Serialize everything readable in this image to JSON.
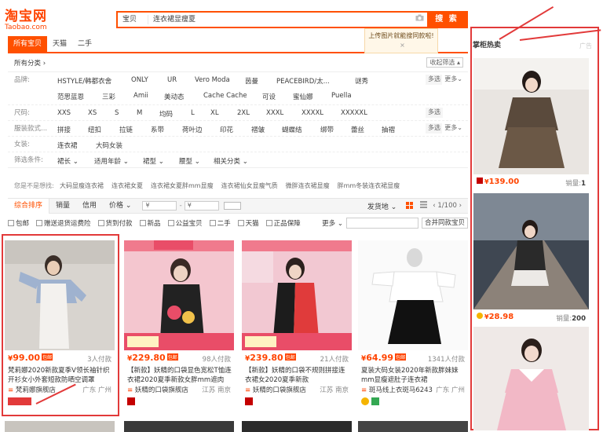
{
  "logo": {
    "cn": "淘宝网",
    "en": "Taobao.com"
  },
  "search": {
    "category": "宝贝",
    "query": "连衣裙显瘦夏",
    "button": "搜 索"
  },
  "tabs": [
    "所有宝贝",
    "天猫",
    "二手"
  ],
  "hint": {
    "text": "上传图片就能搜同款啦!",
    "close": "×"
  },
  "filters": {
    "all_label": "所有分类",
    "collapse": "收起筛选",
    "brand": {
      "label": "品牌:",
      "values": [
        "HSTYLE/韩都衣舍",
        "ONLY",
        "UR",
        "Vero Moda",
        "茵曼",
        "PEACEBIRD/太...",
        "谜秀",
        "范思蓝恩",
        "三彩",
        "Amii",
        "美动态",
        "Cache Cache",
        "可设",
        "蜜仙娜",
        "Puella"
      ],
      "multi": "多选",
      "more": "更多"
    },
    "size": {
      "label": "尺码:",
      "values": [
        "XXS",
        "XS",
        "S",
        "M",
        "均码",
        "L",
        "XL",
        "2XL",
        "XXXL",
        "XXXXL",
        "XXXXXL"
      ],
      "multi": "多选"
    },
    "style": {
      "label": "服装款式...",
      "values": [
        "拼接",
        "纽扣",
        "拉链",
        "系带",
        "荷叶边",
        "印花",
        "褶皱",
        "蝴蝶结",
        "绑带",
        "蕾丝",
        "抽褶"
      ],
      "multi": "多选",
      "more": "更多"
    },
    "women": {
      "label": "女装:",
      "values": [
        "连衣裙",
        "大码女装"
      ]
    },
    "cond": {
      "label": "筛选条件:",
      "values": [
        "裙长",
        "适用年龄",
        "裙型",
        "腰型",
        "相关分类"
      ]
    }
  },
  "suggest": {
    "label": "您是不是想找:",
    "items": [
      "大码显瘦连衣裙",
      "连衣裙女夏",
      "连衣裙女夏胖mm显瘦",
      "连衣裙仙女显瘦气质",
      "微胖连衣裙显瘦",
      "胖mm冬装连衣裙显瘦"
    ]
  },
  "sort": {
    "items": [
      "综合排序",
      "销量",
      "信用",
      "价格"
    ],
    "price_from": "¥",
    "price_to": "¥",
    "ship": "发货地",
    "page": "1/100"
  },
  "opts": {
    "items": [
      "包邮",
      "赠送退货运费险",
      "货到付款",
      "新品",
      "公益宝贝",
      "二手",
      "天猫",
      "正品保障"
    ],
    "more": "更多",
    "compare": "合并同款宝贝"
  },
  "products": [
    {
      "price": "99.00",
      "badge": "包邮",
      "sold": "3人付款",
      "title": "梵莉娜2020新款夏季V领长袖针织开衫女小外套短款防晒空调罩",
      "shop": "梵莉娜旗舰店",
      "loc": "广东 广州"
    },
    {
      "price": "229.80",
      "badge": "包邮",
      "sold": "98人付款",
      "title": "【新款】妖精的口袋显色宽松T恤连衣裙2020夏季新款女胖mm遮肉",
      "shop": "妖精的口袋旗舰店",
      "loc": "江苏 南京"
    },
    {
      "price": "239.80",
      "badge": "包邮",
      "sold": "21人付款",
      "title": "【新款】妖精的口袋不规则拼接连衣裙女2020夏季新款",
      "shop": "妖精的口袋旗舰店",
      "loc": "江苏 南京"
    },
    {
      "price": "64.99",
      "badge": "包邮",
      "sold": "1341人付款",
      "title": "夏装大码女装2020年新款胖妹妹mm显瘦遮肚子连衣裙",
      "shop": "斑马线上衣斑马6243",
      "loc": "广东 广州"
    }
  ],
  "side": {
    "title": "掌柜热卖",
    "items": [
      {
        "price": "139.00",
        "sold_label": "销量:",
        "sold": "1"
      },
      {
        "price": "28.98",
        "sold_label": "销量:",
        "sold": "200"
      }
    ]
  }
}
